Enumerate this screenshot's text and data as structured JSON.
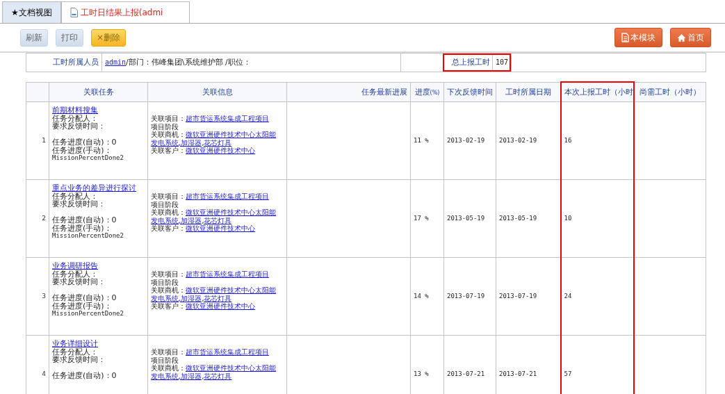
{
  "tabs": [
    {
      "label": "★文档视图",
      "selected": false,
      "icon": false
    },
    {
      "label": "工时日结果上报(admi",
      "selected": true,
      "icon": true
    }
  ],
  "toolbar": {
    "left": [
      {
        "label": "刷新",
        "kind": "plain"
      },
      {
        "label": "打印",
        "kind": "plain"
      },
      {
        "label": "×删除",
        "kind": "warning"
      }
    ],
    "right": [
      {
        "label": "本模块",
        "kind": "module"
      },
      {
        "label": "首页",
        "kind": "home"
      }
    ]
  },
  "owner": {
    "label": "工时所属人员",
    "user": "admin",
    "details": "/部门：伟峰集团\\系统维护部 /职位：",
    "total_label": "总上报工时",
    "total": "107",
    "total_highlighted": true
  },
  "table": {
    "columns": [
      {
        "label": "关联任务",
        "highlighted": false
      },
      {
        "label": "关联信息",
        "highlighted": false
      },
      {
        "label": "任务最新进展",
        "highlighted": false
      },
      {
        "label": "进度",
        "unit": "(%)",
        "highlighted": false
      },
      {
        "label": "下次反馈时间",
        "highlighted": false
      },
      {
        "label": "工时所属日期",
        "highlighted": false
      },
      {
        "label": "本次上报工时（小时",
        "highlighted": true
      },
      {
        "label": "尚需工时（小时）",
        "highlighted": false
      }
    ],
    "rows": [
      {
        "index": "1",
        "task": "前期材料搜集",
        "task_lines": [
          "任务分配人：",
          "要求反馈时间："
        ],
        "detail_lines": [
          "任务进度(自动)：0",
          "任务进度(手动)："
        ],
        "mission_code": "MissionPercentDone2",
        "info": [
          {
            "label": "关联项目：",
            "link": [
              "超市货运系统集成工程项目"
            ]
          },
          {
            "label": "项目阶段"
          },
          {
            "label": "关联商机：",
            "link": [
              "微软亚洲硬件技术中心太阳能",
              "发电系统,加湿器,花芯灯具"
            ]
          },
          {
            "label": "关联客户：",
            "link": [
              "微软亚洲硬件技术中心"
            ]
          }
        ],
        "percent": "11 %",
        "next_date": "2013-02-19",
        "date": "2013-02-19",
        "hours": "16"
      },
      {
        "index": "2",
        "task": "重点业务的差异进行探讨",
        "task_lines": [
          "任务分配人：",
          "要求反馈时间："
        ],
        "detail_lines": [
          "任务进度(自动)：0",
          "任务进度(手动)："
        ],
        "mission_code": "MissionPercentDone2",
        "info": [
          {
            "label": "关联项目：",
            "link": [
              "超市货运系统集成工程项目"
            ]
          },
          {
            "label": "项目阶段"
          },
          {
            "label": "关联商机：",
            "link": [
              "微软亚洲硬件技术中心太阳能",
              "发电系统,加湿器,花芯灯具"
            ]
          },
          {
            "label": "关联客户：",
            "link": [
              "微软亚洲硬件技术中心"
            ]
          }
        ],
        "percent": "17 %",
        "next_date": "2013-05-19",
        "date": "2013-05-19",
        "hours": "10"
      },
      {
        "index": "3",
        "task": "业务调研报告",
        "task_lines": [
          "任务分配人：",
          "要求反馈时间："
        ],
        "detail_lines": [
          "任务进度(自动)：0",
          "任务进度(手动)："
        ],
        "mission_code": "MissionPercentDone2",
        "info": [
          {
            "label": "关联项目：",
            "link": [
              "超市货运系统集成工程项目"
            ]
          },
          {
            "label": "项目阶段"
          },
          {
            "label": "关联商机：",
            "link": [
              "微软亚洲硬件技术中心太阳能",
              "发电系统,加湿器,花芯灯具"
            ]
          },
          {
            "label": "关联客户：",
            "link": [
              "微软亚洲硬件技术中心"
            ]
          }
        ],
        "percent": "14 %",
        "next_date": "2013-07-19",
        "date": "2013-07-19",
        "hours": "24"
      },
      {
        "index": "4",
        "task": "业务详细设计",
        "task_lines": [
          "任务分配人：",
          "要求反馈时间："
        ],
        "detail_lines": [
          "任务进度(自动)：0"
        ],
        "info": [
          {
            "label": "关联项目：",
            "link": [
              "超市货运系统集成工程项目"
            ]
          },
          {
            "label": "项目阶段"
          },
          {
            "label": "关联商机：",
            "link": [
              "微软亚洲硬件技术中心太阳能",
              "发电系统,加湿器,花芯灯具"
            ]
          }
        ],
        "percent": "13 %",
        "next_date": "2013-07-21",
        "date": "2013-07-21",
        "hours": "57"
      }
    ]
  }
}
